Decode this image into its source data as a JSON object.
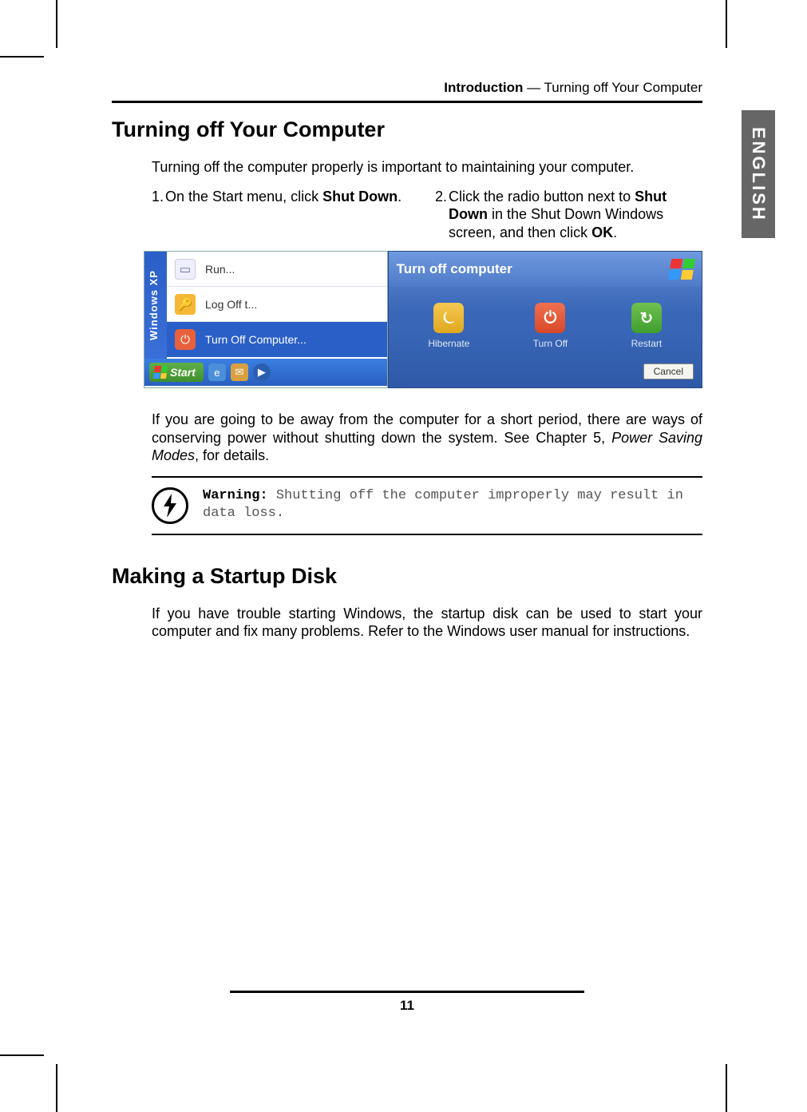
{
  "header": {
    "chapter": "Introduction",
    "separator": " — ",
    "section": "Turning off Your Computer"
  },
  "language_tab": "ENGLISH",
  "section1": {
    "title": "Turning off Your Computer",
    "intro": "Turning off the computer properly is important to maintaining your computer.",
    "step1_num": "1.",
    "step1_pre": "On the Start menu, click ",
    "step1_bold": "Shut Down",
    "step1_post": ".",
    "step2_num": "2.",
    "step2_pre": "Click the radio button next to ",
    "step2_bold1": "Shut Down",
    "step2_mid": " in the Shut Down Windows screen, and then click ",
    "step2_bold2": "OK",
    "step2_post": ".",
    "after_shots_pre": "If you are going to be away from the computer for a short period, there are ways of conserving power without shutting down the system. See Chapter 5, ",
    "after_shots_italic": "Power Saving Modes",
    "after_shots_post": ", for details."
  },
  "start_menu": {
    "sidebar": "Windows XP",
    "run": "Run...",
    "logoff": "Log Off t...",
    "turnoff": "Turn Off Computer...",
    "start": "Start"
  },
  "dialog": {
    "title": "Turn off computer",
    "hibernate": "Hibernate",
    "turnoff": "Turn Off",
    "restart": "Restart",
    "cancel": "Cancel"
  },
  "warning": {
    "label": "Warning:",
    "text": " Shutting off the computer improperly may result in data loss."
  },
  "section2": {
    "title": "Making a Startup Disk",
    "body": "If you have trouble starting Windows, the startup disk can be used to start your computer and fix many problems. Refer to the Windows user manual for instructions."
  },
  "page_number": "11"
}
